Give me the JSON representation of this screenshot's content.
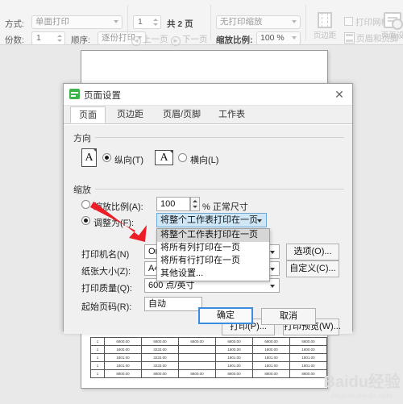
{
  "toolbar": {
    "mode_label": "方式:",
    "mode_value": "单面打印",
    "copies_label": "份数:",
    "copies_value": "1",
    "order_label": "顺序:",
    "order_value": "逐份打印",
    "page_number": "1",
    "page_total": "共 2 页",
    "prev_page": "上一页",
    "prev_icon": "◄",
    "next_page": "下一页",
    "next_icon": "►",
    "print_scaling_value": "无打印缩放",
    "zoom_label": "缩放比例:",
    "zoom_value": "100 %",
    "margins_button": "页边距",
    "gridlines_checkbox": "打印网格线",
    "header_footer_button": "页眉和页脚",
    "page_setup_button": "页面设"
  },
  "dialog": {
    "title": "页面设置",
    "close_icon": "✕",
    "tabs": [
      {
        "label": "页面",
        "active": true
      },
      {
        "label": "页边距",
        "active": false
      },
      {
        "label": "页眉/页脚",
        "active": false
      },
      {
        "label": "工作表",
        "active": false
      }
    ],
    "orientation": {
      "group_title": "方向",
      "portrait_label": "纵向(T)",
      "portrait_selected": true,
      "landscape_label": "横向(L)",
      "landscape_selected": false,
      "icon_glyph": "A"
    },
    "scaling": {
      "group_title": "缩放",
      "scale_radio_label": "缩放比例(A):",
      "scale_radio_selected": false,
      "scale_value": "100",
      "scale_suffix": "% 正常尺寸",
      "fit_radio_label": "调整为(F):",
      "fit_radio_selected": true,
      "fit_value": "将整个工作表打印在一页",
      "dropdown_options": [
        {
          "label": "将整个工作表打印在一页",
          "highlighted": true
        },
        {
          "label": "将所有列打印在一页",
          "highlighted": false
        },
        {
          "label": "将所有行打印在一页",
          "highlighted": false
        },
        {
          "label": "其他设置...",
          "highlighted": false
        }
      ]
    },
    "printer": {
      "name_label": "打印机名(N)",
      "name_value": "One",
      "options_button": "选项(O)...",
      "paper_label": "纸张大小(Z):",
      "paper_value": "A4",
      "custom_button": "自定义(C)...",
      "quality_label": "打印质量(Q):",
      "quality_value": "600 点/英寸",
      "start_page_label": "起始页码(R):",
      "start_page_value": "自动"
    },
    "buttons": {
      "print": "打印(P)...",
      "preview": "打印预览(W)...",
      "ok": "确定",
      "cancel": "取消"
    }
  },
  "watermark": {
    "main": "Baidu经验",
    "sub": "jingyan.baidu.com"
  },
  "sheet": {
    "rows": [
      [
        "1",
        "6800.00",
        "6800.00",
        "6800.00",
        "6800.00",
        "6800.00",
        "6800.00"
      ],
      [
        "1",
        "1800.00",
        "3233.00",
        "",
        "1800.00",
        "1800.00",
        "1800.00"
      ],
      [
        "1",
        "1801.00",
        "3233.00",
        "",
        "1801.00",
        "1801.00",
        "1801.00"
      ],
      [
        "1",
        "1801.00",
        "3233.00",
        "",
        "1801.00",
        "1801.00",
        "1801.00"
      ],
      [
        "1",
        "8800.00",
        "8800.00",
        "8800.00",
        "8800.00",
        "8800.00",
        "8800.00"
      ]
    ]
  }
}
